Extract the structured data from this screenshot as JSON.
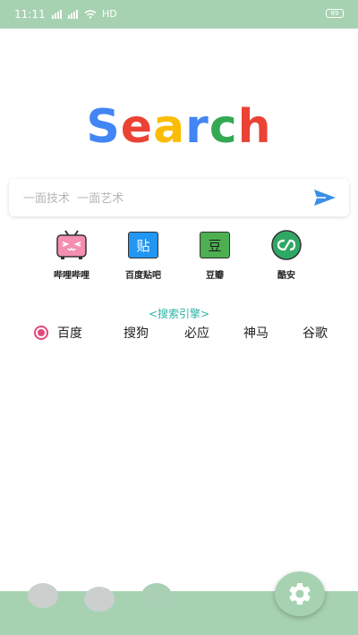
{
  "status_bar": {
    "time": "11:11",
    "network_label": "HD",
    "battery_label": "89"
  },
  "logo": {
    "letters": [
      "S",
      "e",
      "a",
      "r",
      "c",
      "h"
    ],
    "colors": [
      "#4285f4",
      "#ea4335",
      "#fbbc05",
      "#4285f4",
      "#34a853",
      "#ea4335"
    ]
  },
  "search": {
    "placeholder": "一面技术  一面艺术",
    "value": "",
    "send_icon": "send-icon"
  },
  "quick_links": [
    {
      "label": "哔哩哔哩",
      "icon": "bilibili-icon"
    },
    {
      "label": "百度贴吧",
      "icon": "tieba-icon",
      "icon_text": "贴"
    },
    {
      "label": "豆瓣",
      "icon": "douban-icon",
      "icon_text": "豆"
    },
    {
      "label": "酷安",
      "icon": "coolapk-icon"
    }
  ],
  "engines": {
    "title": "<搜索引擎>",
    "items": [
      "百度",
      "搜狗",
      "必应",
      "神马",
      "谷歌"
    ],
    "selected": "百度"
  },
  "bottom_bar": {
    "settings_icon": "gear-icon"
  },
  "colors": {
    "accent_green": "#a7d2b2",
    "radio_pink": "#e2497a",
    "title_teal": "#2ab3a6"
  }
}
